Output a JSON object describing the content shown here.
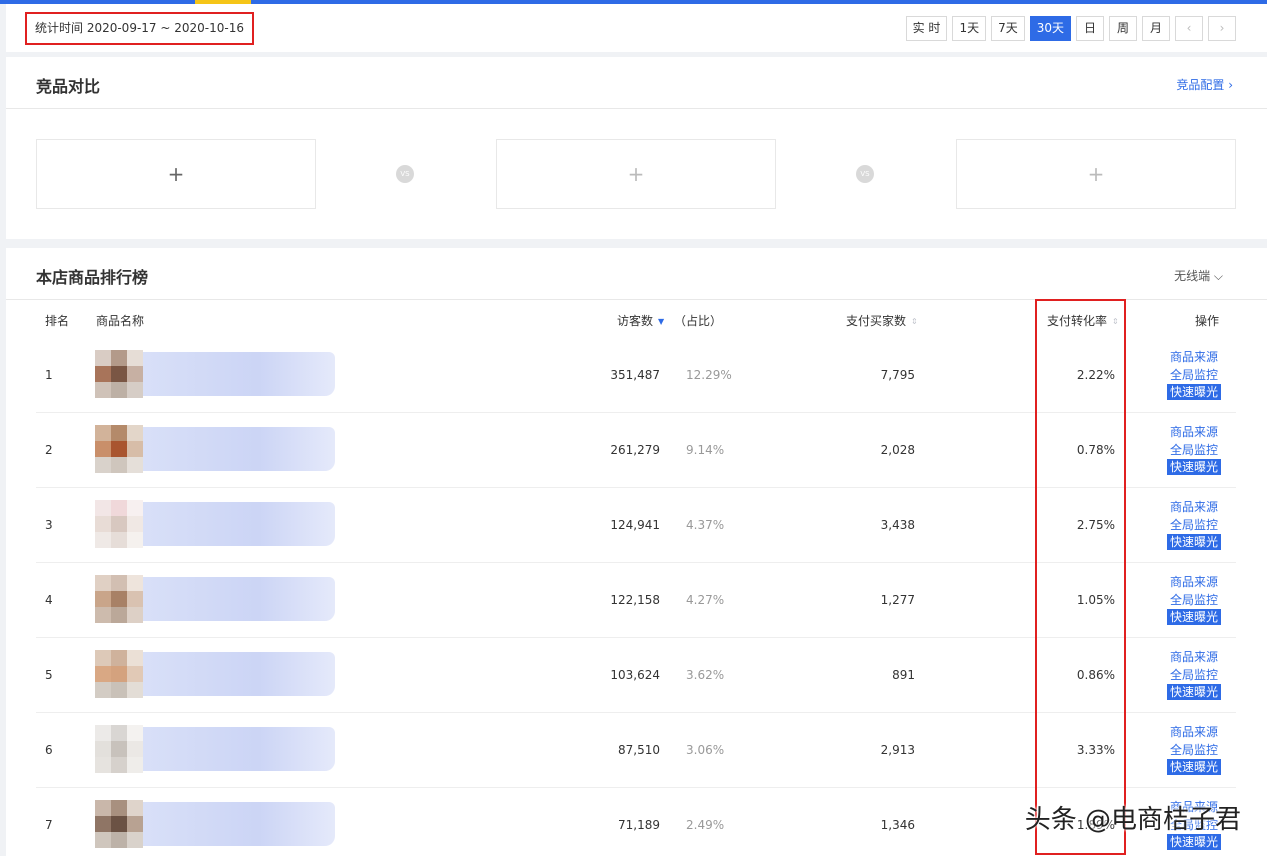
{
  "header": {
    "date_range": "统计时间 2020-09-17 ~ 2020-10-16",
    "periods": [
      {
        "label": "实 时",
        "active": false
      },
      {
        "label": "1天",
        "active": false
      },
      {
        "label": "7天",
        "active": false
      },
      {
        "label": "30天",
        "active": true
      },
      {
        "label": "日",
        "active": false
      },
      {
        "label": "周",
        "active": false
      },
      {
        "label": "月",
        "active": false
      }
    ],
    "prev": "‹",
    "next": "›"
  },
  "compare": {
    "title": "竞品对比",
    "config_link": "竞品配置 ›",
    "slot_icon": "+",
    "vs_label": "VS"
  },
  "ranking": {
    "title": "本店商品排行榜",
    "channel": "无线端 ⌵",
    "columns": {
      "rank": "排名",
      "name": "商品名称",
      "visitors": "访客数",
      "share": "（占比）",
      "buyers": "支付买家数",
      "conversion": "支付转化率",
      "action": "操作"
    },
    "actions": {
      "source": "商品来源",
      "monitor": "全局监控",
      "fast": "快速曝光"
    },
    "rows": [
      {
        "rank": "1",
        "visitors": "351,487",
        "share": "12.29%",
        "buyers": "7,795",
        "conversion": "2.22%"
      },
      {
        "rank": "2",
        "visitors": "261,279",
        "share": "9.14%",
        "buyers": "2,028",
        "conversion": "0.78%"
      },
      {
        "rank": "3",
        "visitors": "124,941",
        "share": "4.37%",
        "buyers": "3,438",
        "conversion": "2.75%"
      },
      {
        "rank": "4",
        "visitors": "122,158",
        "share": "4.27%",
        "buyers": "1,277",
        "conversion": "1.05%"
      },
      {
        "rank": "5",
        "visitors": "103,624",
        "share": "3.62%",
        "buyers": "891",
        "conversion": "0.86%"
      },
      {
        "rank": "6",
        "visitors": "87,510",
        "share": "3.06%",
        "buyers": "2,913",
        "conversion": "3.33%"
      },
      {
        "rank": "7",
        "visitors": "71,189",
        "share": "2.49%",
        "buyers": "1,346",
        "conversion": "1.89%"
      }
    ]
  },
  "watermark": "头条 @电商桔子君",
  "colors": {
    "accent": "#2e6be6",
    "highlight": "#e02020"
  }
}
